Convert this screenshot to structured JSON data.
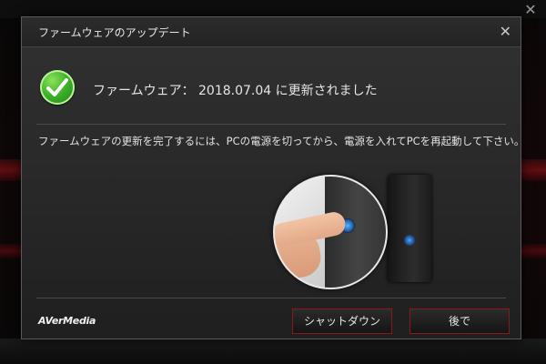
{
  "dialog": {
    "title": "ファームウェアのアップデート",
    "headline": "ファームウェア： 2018.07.04 に更新されました",
    "message": "ファームウェアの更新を完了するには、PCの電源を切ってから、電源を入れてPCを再起動して下さい。",
    "close_glyph": "✕",
    "logo_text": "AVerMedia",
    "buttons": {
      "shutdown": "シャットダウン",
      "later": "後で"
    }
  },
  "background": {
    "close_glyph": "✕"
  },
  "colors": {
    "accent_red": "#8a1a1a",
    "check_green": "#3fb22a",
    "text": "#e6e6e6"
  },
  "icons": [
    "checkmark-icon",
    "close-icon"
  ]
}
